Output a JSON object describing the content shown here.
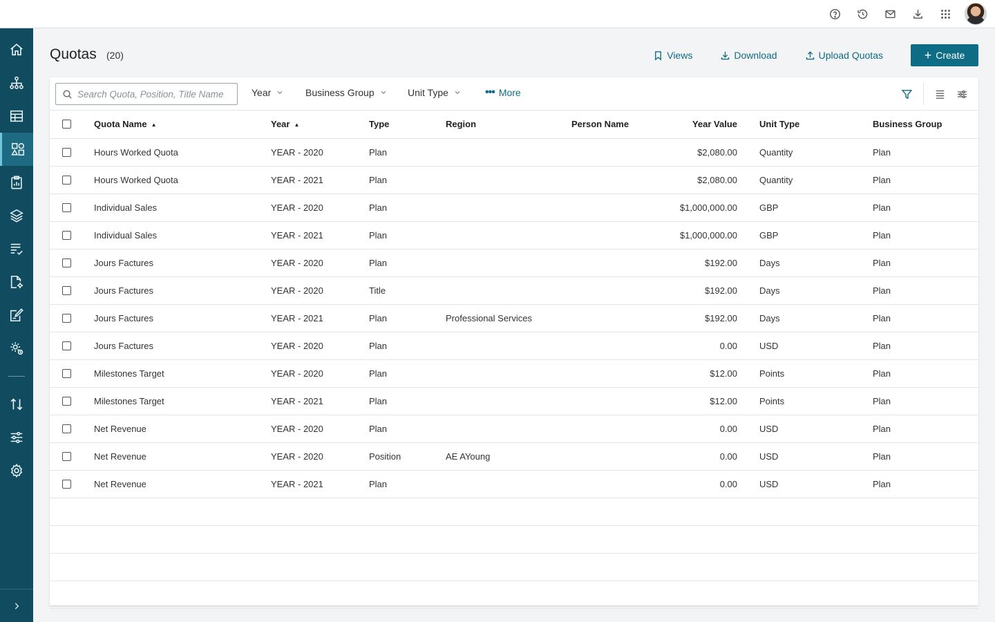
{
  "header": {
    "title": "Quotas",
    "count": "(20)",
    "actions": {
      "views": "Views",
      "download": "Download",
      "upload": "Upload Quotas",
      "create": "Create"
    }
  },
  "topbar": {
    "icons": [
      "help-icon",
      "history-icon",
      "mail-icon",
      "download-icon",
      "apps-grid-icon"
    ]
  },
  "sidebar": {
    "items": [
      "home-icon",
      "org-chart-icon",
      "table-icon",
      "shapes-icon",
      "clipboard-icon",
      "layers-icon",
      "checklist-icon",
      "document-settings-icon",
      "edit-document-icon",
      "gears-icon",
      "sort-arrows-icon",
      "sliders-icon",
      "settings-icon"
    ],
    "active_index": 3
  },
  "toolbar": {
    "search_placeholder": "Search Quota, Position, Title Name",
    "filters": [
      "Year",
      "Business Group",
      "Unit Type"
    ],
    "more": "More"
  },
  "table": {
    "columns": [
      "Quota Name",
      "Year",
      "Type",
      "Region",
      "Person Name",
      "Year Value",
      "Unit Type",
      "Business Group"
    ],
    "rows": [
      [
        "Hours Worked Quota",
        "YEAR - 2020",
        "Plan",
        "",
        "",
        "$2,080.00",
        "Quantity",
        "Plan"
      ],
      [
        "Hours Worked Quota",
        "YEAR - 2021",
        "Plan",
        "",
        "",
        "$2,080.00",
        "Quantity",
        "Plan"
      ],
      [
        "Individual Sales",
        "YEAR - 2020",
        "Plan",
        "",
        "",
        "$1,000,000.00",
        "GBP",
        "Plan"
      ],
      [
        "Individual Sales",
        "YEAR - 2021",
        "Plan",
        "",
        "",
        "$1,000,000.00",
        "GBP",
        "Plan"
      ],
      [
        "Jours Factures",
        "YEAR - 2020",
        "Plan",
        "",
        "",
        "$192.00",
        "Days",
        "Plan"
      ],
      [
        "Jours Factures",
        "YEAR - 2020",
        "Title",
        "",
        "",
        "$192.00",
        "Days",
        "Plan"
      ],
      [
        "Jours Factures",
        "YEAR - 2021",
        "Plan",
        "Professional Services",
        "",
        "$192.00",
        "Days",
        "Plan"
      ],
      [
        "Jours Factures",
        "YEAR - 2020",
        "Plan",
        "",
        "",
        "0.00",
        "USD",
        "Plan"
      ],
      [
        "Milestones Target",
        "YEAR - 2020",
        "Plan",
        "",
        "",
        "$12.00",
        "Points",
        "Plan"
      ],
      [
        "Milestones Target",
        "YEAR - 2021",
        "Plan",
        "",
        "",
        "$12.00",
        "Points",
        "Plan"
      ],
      [
        "Net Revenue",
        "YEAR - 2020",
        "Plan",
        "",
        "",
        "0.00",
        "USD",
        "Plan"
      ],
      [
        "Net Revenue",
        "YEAR - 2020",
        "Position",
        "AE AYoung",
        "",
        "0.00",
        "USD",
        "Plan"
      ],
      [
        "Net Revenue",
        "YEAR - 2021",
        "Plan",
        "",
        "",
        "0.00",
        "USD",
        "Plan"
      ]
    ],
    "empty_rows": 4
  }
}
